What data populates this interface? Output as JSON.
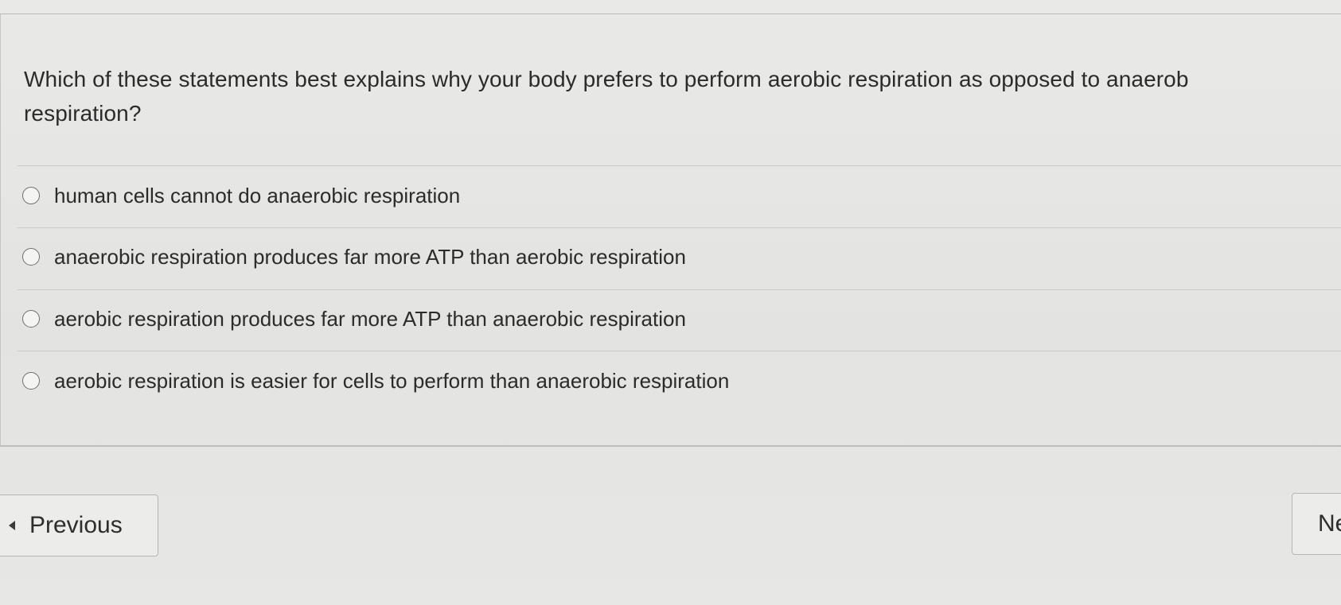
{
  "question": {
    "text": "Which of these statements best explains why your body prefers to perform aerobic respiration as opposed to anaerob\nrespiration?"
  },
  "options": [
    {
      "label": "human cells cannot do anaerobic respiration"
    },
    {
      "label": "anaerobic respiration produces far more ATP than aerobic respiration"
    },
    {
      "label": "aerobic respiration produces far more ATP than anaerobic respiration"
    },
    {
      "label": "aerobic respiration is easier for cells to perform than anaerobic respiration"
    }
  ],
  "nav": {
    "previous_label": "Previous",
    "next_label": "Ne"
  }
}
